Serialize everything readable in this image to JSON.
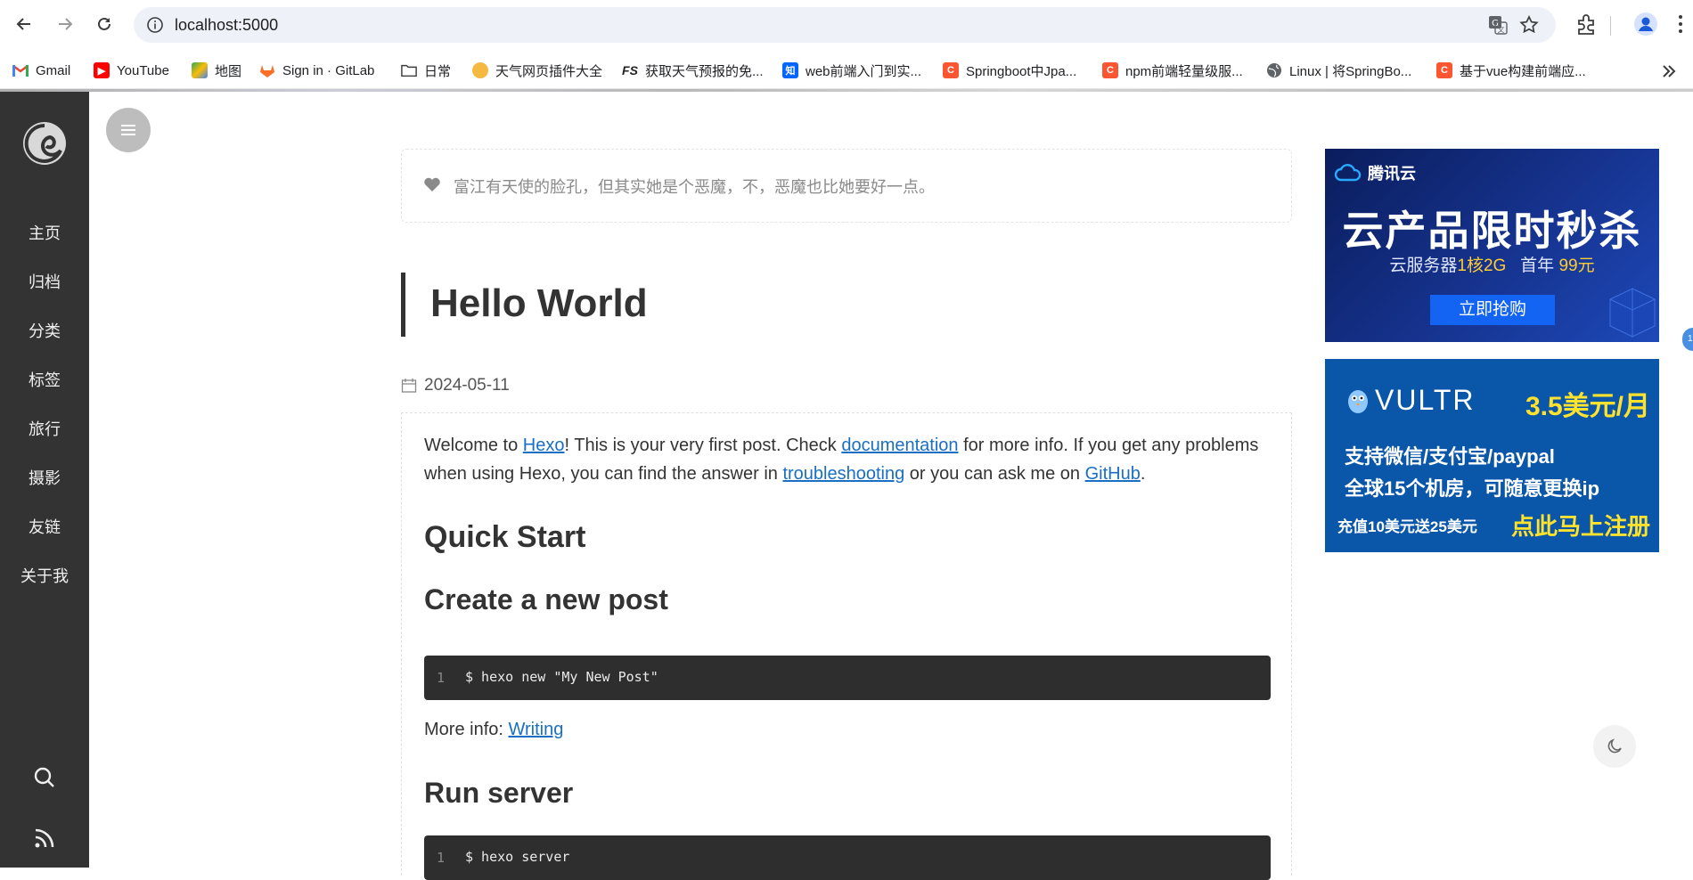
{
  "browser": {
    "url": "localhost:5000",
    "bookmarks": [
      {
        "label": "Gmail",
        "icon": "gmail-icon",
        "color": "#ea4335"
      },
      {
        "label": "YouTube",
        "icon": "youtube-icon",
        "color": "#ff0000"
      },
      {
        "label": "地图",
        "icon": "maps-icon",
        "color": "#34a853"
      },
      {
        "label": "Sign in · GitLab",
        "icon": "gitlab-icon",
        "color": "#fc6d26"
      },
      {
        "label": "日常",
        "icon": "folder-icon",
        "color": "#5f6368"
      },
      {
        "label": "天气网页插件大全",
        "icon": "weather-icon",
        "color": "#f5b942"
      },
      {
        "label": "获取天气预报的免...",
        "icon": "fs-icon",
        "color": "#222222"
      },
      {
        "label": "web前端入门到实...",
        "icon": "zhihu-icon",
        "color": "#0066ff"
      },
      {
        "label": "Springboot中Jpa...",
        "icon": "csdn-icon",
        "color": "#fc5531"
      },
      {
        "label": "npm前端轻量级服...",
        "icon": "csdn-icon",
        "color": "#fc5531"
      },
      {
        "label": "Linux | 将SpringBo...",
        "icon": "globe-icon",
        "color": "#5f6368"
      },
      {
        "label": "基于vue构建前端应...",
        "icon": "csdn-icon",
        "color": "#fc5531"
      }
    ]
  },
  "sidebar": {
    "items": [
      "主页",
      "归档",
      "分类",
      "标签",
      "旅行",
      "摄影",
      "友链",
      "关于我"
    ]
  },
  "motto": "富江有天使的脸孔，但其实她是个恶魔，不，恶魔也比她要好一点。",
  "post": {
    "title": "Hello World",
    "date": "2024-05-11",
    "intro": {
      "t1": "Welcome to ",
      "link1": "Hexo",
      "t2": "! This is your very first post. Check ",
      "link2": "documentation",
      "t3": " for more info. If you get any problems when using Hexo, you can find the answer in ",
      "link3": "troubleshooting",
      "t4": " or you can ask me on ",
      "link4": "GitHub",
      "t5": "."
    },
    "h_quick": "Quick Start",
    "h_create": "Create a new post",
    "code1": {
      "line": "1",
      "cmd": "$ hexo new \"My New Post\""
    },
    "more_label": "More info: ",
    "more_link": "Writing",
    "h_run": "Run server",
    "code2": {
      "line": "1",
      "cmd": "$ hexo server"
    }
  },
  "ads": {
    "tencent": {
      "brand": "腾讯云",
      "headline": "云产品限时秒杀",
      "sub_prefix": "云服务器",
      "sub_spec": "1核2G",
      "sub_mid": "首年",
      "sub_price": "99元",
      "button": "立即抢购"
    },
    "vultr": {
      "brand": "VULTR",
      "price": "3.5美元/月",
      "line1": "支持微信/支付宝/paypal",
      "line2": "全球15个机房，可随意更换ip",
      "line3a": "充值10美元送25美元",
      "line3b": "点此马上注册"
    }
  },
  "edge_badge": "1"
}
